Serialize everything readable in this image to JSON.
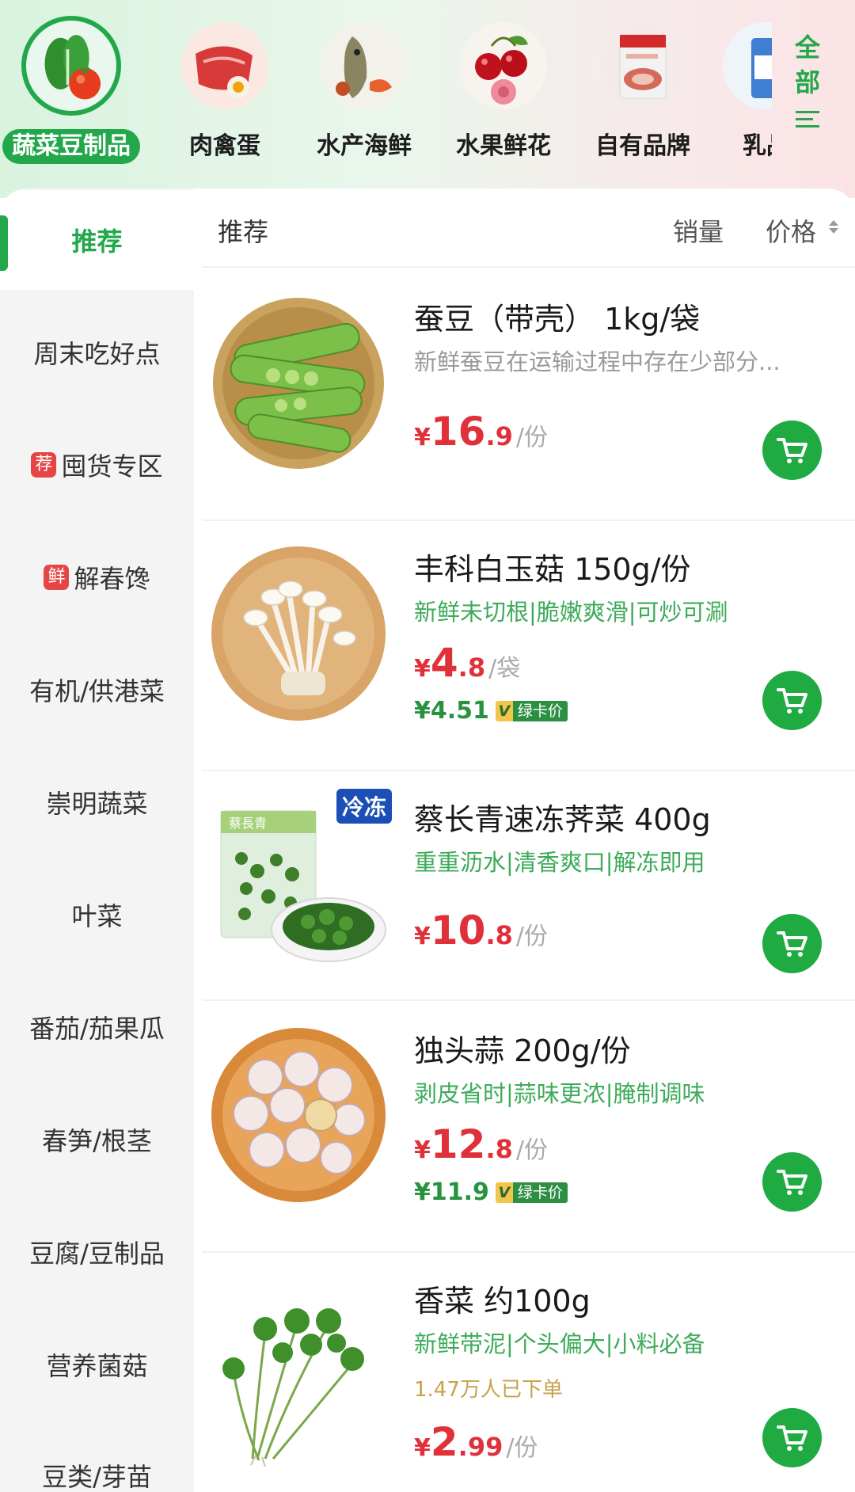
{
  "categories": [
    {
      "label": "蔬菜豆制品",
      "icon": "vegetable-icon",
      "active": true
    },
    {
      "label": "肉禽蛋",
      "icon": "meat-egg-icon",
      "active": false
    },
    {
      "label": "水产海鲜",
      "icon": "seafood-icon",
      "active": false
    },
    {
      "label": "水果鲜花",
      "icon": "fruit-flower-icon",
      "active": false
    },
    {
      "label": "自有品牌",
      "icon": "own-brand-icon",
      "active": false
    },
    {
      "label": "乳品",
      "icon": "dairy-icon",
      "active": false
    }
  ],
  "all_button": {
    "line1": "全",
    "line2": "部",
    "icon": "menu-lines-icon"
  },
  "sidebar": {
    "items": [
      {
        "label": "推荐",
        "active": true
      },
      {
        "label": "周末吃好点"
      },
      {
        "label": "囤货专区",
        "badge": "荐"
      },
      {
        "label": "解春馋",
        "badge": "鲜"
      },
      {
        "label": "有机/供港菜"
      },
      {
        "label": "崇明蔬菜"
      },
      {
        "label": "叶菜"
      },
      {
        "label": "番茄/茄果瓜"
      },
      {
        "label": "春笋/根茎"
      },
      {
        "label": "豆腐/豆制品"
      },
      {
        "label": "营养菌菇"
      },
      {
        "label": "豆类/芽苗"
      }
    ]
  },
  "sort_bar": {
    "recommend": "推荐",
    "sales": "销量",
    "price": "价格"
  },
  "products": [
    {
      "title": "蚕豆（带壳） 1kg/袋",
      "subtitle": "新鲜蚕豆在运输过程中存在少部分...",
      "subtitle_style": "gray",
      "currency": "¥",
      "price_int": "16",
      "price_dec": ".9",
      "unit": "/份",
      "image": "broad-beans-image"
    },
    {
      "title": "丰科白玉菇 150g/份",
      "subtitle": "新鲜未切根|脆嫩爽滑|可炒可涮",
      "subtitle_style": "green",
      "currency": "¥",
      "price_int": "4",
      "price_dec": ".8",
      "unit": "/袋",
      "member_price": "¥4.51",
      "member_v": "V",
      "member_label": "绿卡价",
      "image": "white-mushroom-image"
    },
    {
      "title": "蔡长青速冻荠菜 400g",
      "subtitle": "重重沥水|清香爽口|解冻即用",
      "subtitle_style": "green",
      "currency": "¥",
      "price_int": "10",
      "price_dec": ".8",
      "unit": "/份",
      "tag": "冷冻",
      "image": "frozen-shepherds-purse-image",
      "package_text": "蔡長青"
    },
    {
      "title": "独头蒜 200g/份",
      "subtitle": "剥皮省时|蒜味更浓|腌制调味",
      "subtitle_style": "green",
      "currency": "¥",
      "price_int": "12",
      "price_dec": ".8",
      "unit": "/份",
      "member_price": "¥11.9",
      "member_v": "V",
      "member_label": "绿卡价",
      "image": "garlic-image"
    },
    {
      "title": "香菜 约100g",
      "subtitle": "新鲜带泥|个头偏大|小料必备",
      "subtitle_style": "green",
      "sold": "1.47万人已下单",
      "currency": "¥",
      "price_int": "2",
      "price_dec": ".99",
      "unit": "/份",
      "image": "coriander-image"
    }
  ],
  "colors": {
    "accent": "#22a84a",
    "price": "#e0303a",
    "frozen_tag": "#1b4fb5",
    "member_green": "#27933f"
  }
}
